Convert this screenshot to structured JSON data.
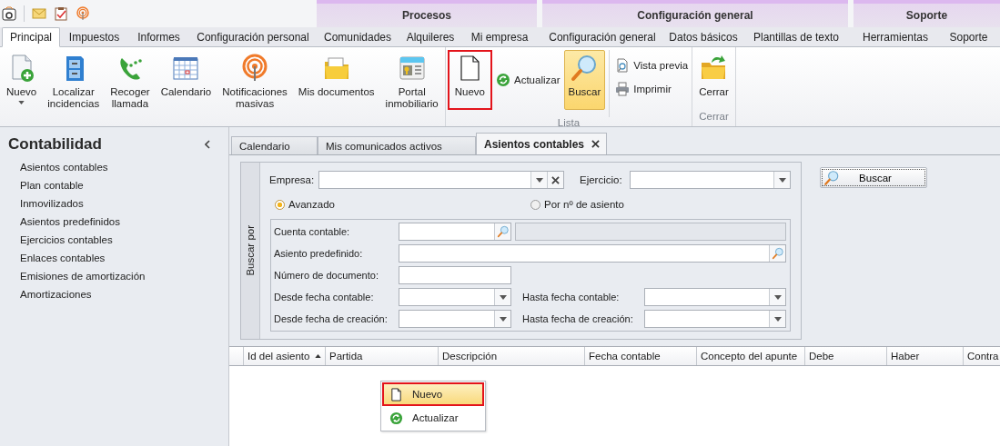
{
  "context_groups": [
    {
      "title": "Procesos"
    },
    {
      "title": "Configuración general"
    },
    {
      "title": "Soporte"
    }
  ],
  "ribbon_tabs": [
    {
      "label": "Principal",
      "selected": true
    },
    {
      "label": "Impuestos",
      "selected": false
    },
    {
      "label": "Informes",
      "selected": false
    },
    {
      "label": "Configuración personal",
      "selected": false
    },
    {
      "label": "Comunidades",
      "selected": false
    },
    {
      "label": "Alquileres",
      "selected": false
    },
    {
      "label": "Mi empresa",
      "selected": false
    },
    {
      "label": "Configuración general",
      "selected": false
    },
    {
      "label": "Datos básicos",
      "selected": false
    },
    {
      "label": "Plantillas de texto",
      "selected": false
    },
    {
      "label": "Herramientas",
      "selected": false
    },
    {
      "label": "Soporte",
      "selected": false
    }
  ],
  "ribbon_groups": [
    {
      "items": [
        {
          "kind": "large",
          "label": "Nuevo",
          "dropdown": true
        },
        {
          "kind": "large",
          "label": "Localizar\nincidencias"
        },
        {
          "kind": "large",
          "label": "Recoger\nllamada"
        },
        {
          "kind": "large",
          "label": "Calendario"
        },
        {
          "kind": "large",
          "label": "Notificaciones\nmasivas"
        },
        {
          "kind": "large",
          "label": "Mis documentos"
        },
        {
          "kind": "large",
          "label": "Portal\ninmobiliario"
        }
      ]
    },
    {
      "title": "Lista",
      "items": [
        {
          "kind": "large",
          "label": "Nuevo",
          "highlighted": true
        },
        {
          "kind": "small",
          "label": "Actualizar"
        },
        {
          "kind": "large",
          "label": "Buscar",
          "pressed": true
        },
        {
          "kind": "stack",
          "buttons": [
            {
              "label": "Vista previa"
            },
            {
              "label": "Imprimir"
            }
          ]
        }
      ]
    },
    {
      "title": "Cerrar",
      "items": [
        {
          "kind": "large",
          "label": "Cerrar"
        }
      ]
    }
  ],
  "sidebar": {
    "title": "Contabilidad",
    "items": [
      "Asientos contables",
      "Plan contable",
      "Inmovilizados",
      "Asientos predefinidos",
      "Ejercicios contables",
      "Enlaces contables",
      "Emisiones de amortización",
      "Amortizaciones"
    ]
  },
  "doc_tabs": [
    {
      "label": "Calendario",
      "selected": false
    },
    {
      "label": "Mis comunicados activos",
      "selected": false
    },
    {
      "label": "Asientos contables",
      "selected": true,
      "closable": true
    }
  ],
  "search": {
    "side_label": "Buscar por",
    "empresa_label": "Empresa:",
    "ejercicio_label": "Ejercicio:",
    "modes": [
      {
        "label": "Avanzado",
        "selected": true
      },
      {
        "label": "Por nº de asiento",
        "selected": false
      }
    ],
    "filters": [
      {
        "fields": [
          {
            "label": "Cuenta contable:",
            "kind": "lookup"
          },
          {
            "kind": "display"
          }
        ]
      },
      {
        "fields": [
          {
            "label": "Asiento predefinido:",
            "kind": "lookup_wide"
          }
        ]
      },
      {
        "fields": [
          {
            "label": "Número de documento:",
            "kind": "text"
          }
        ]
      },
      {
        "fields": [
          {
            "label": "Desde fecha contable:",
            "kind": "date"
          },
          {
            "label": "Hasta fecha contable:",
            "kind": "date"
          }
        ]
      },
      {
        "fields": [
          {
            "label": "Desde fecha de creación:",
            "kind": "date"
          },
          {
            "label": "Hasta fecha de creación:",
            "kind": "date"
          }
        ]
      }
    ],
    "button": "Buscar"
  },
  "table": {
    "columns": [
      {
        "label": "Id del asiento",
        "sorted": true
      },
      {
        "label": "Partida",
        "sorted": false
      },
      {
        "label": "Descripción",
        "sorted": false
      },
      {
        "label": "Fecha contable",
        "sorted": false
      },
      {
        "label": "Concepto del apunte",
        "sorted": false
      },
      {
        "label": "Debe",
        "sorted": false
      },
      {
        "label": "Haber",
        "sorted": false
      },
      {
        "label": "Contra",
        "sorted": false
      }
    ]
  },
  "context_menu": {
    "items": [
      {
        "label": "Nuevo",
        "selected": true,
        "highlighted": true
      },
      {
        "label": "Actualizar",
        "selected": false,
        "highlighted": false
      }
    ]
  }
}
